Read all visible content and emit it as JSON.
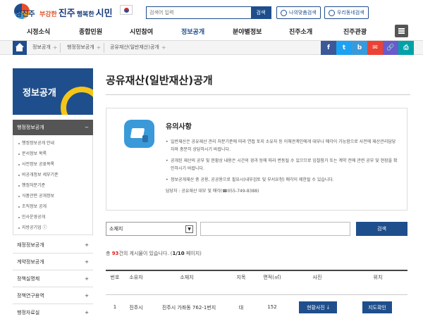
{
  "header": {
    "logo_text": "참진주",
    "slogan": [
      "부강한",
      "진주",
      "행복한",
      "시민"
    ],
    "search_placeholder": "검색어 입력",
    "search_button": "검색",
    "quick": [
      {
        "label": "나의맞춤검색"
      },
      {
        "label": "우리동네검색"
      }
    ]
  },
  "gnb": [
    "시정소식",
    "종합민원",
    "시민참여",
    "정보공개",
    "분야별정보",
    "진주소개",
    "진주관광"
  ],
  "breadcrumb": [
    "정보공개",
    "행정정보공개",
    "공유재산(일반재산)공개"
  ],
  "share": {
    "labels": [
      "f",
      "t",
      "b",
      "✉",
      "🔗",
      "⎙"
    ],
    "colors": [
      "#3b5998",
      "#1da1f2",
      "#3a9ad9",
      "#ea4335",
      "#6a5acd",
      "#00a2a8"
    ]
  },
  "sidebar": {
    "banner_title": "정보공개",
    "active": {
      "label": "행정정보공개",
      "toggle": "−"
    },
    "sub_items": [
      "행정정보공개 안내",
      "문서정보 목록",
      "사전정보 공표목록",
      "비공개정보 세부기준",
      "행정처분기준",
      "식품관련 공개정보",
      "조직정보 공개",
      "인사운영공개",
      "지방공기업 ⓘ"
    ],
    "items": [
      {
        "label": "재정정보공개",
        "toggle": "+"
      },
      {
        "label": "계약정보공개",
        "toggle": "+"
      },
      {
        "label": "정책실명제",
        "toggle": "+"
      },
      {
        "label": "정책연구용역",
        "toggle": "+"
      },
      {
        "label": "행정자료실",
        "toggle": "+"
      }
    ]
  },
  "main": {
    "title": "공유재산(일반재산)공개",
    "notice": {
      "title": "유의사항",
      "bullets": [
        "일반재산은 공유재산 관리 처분기준에 따라 연접 토지 소유자 등 이해관계인에게 대부나 매각이 가능함으로 사전에 재산관리담당자와 충분히 상담하시기 바랍니다.",
        "공개된 재산의 공부 및 현황상 내용은 시간의 경과 등에 따라 변동될 수 있으므로 입찰참가 또는 계약 전에 관련 공부 및 현장을 확인하시기 바랍니다.",
        "정보공개재산 중 공용, 공공용으로 필요시(내부검토 및 부서요청) 매각이 제한될 수 있습니다."
      ],
      "contact": "담당자 : 공유재산 대부 및 매각(☎055-749-8388)"
    },
    "search": {
      "select_value": "소재지",
      "button": "검색"
    },
    "count": {
      "prefix": "총",
      "total": "93",
      "mid": "건의 게시물이 있습니다. (",
      "page": "1/10",
      "suffix": " 페이지)"
    },
    "table": {
      "headers": [
        "번호",
        "소유자",
        "소재지",
        "지목",
        "면적(㎡)",
        "사진",
        "위치"
      ],
      "rows": [
        {
          "no": "1",
          "owner": "진주시",
          "location": "진주시 가좌동 762-1번지",
          "category": "대",
          "area": "152",
          "photo": "현황사진",
          "map": "지도확인"
        }
      ]
    }
  }
}
